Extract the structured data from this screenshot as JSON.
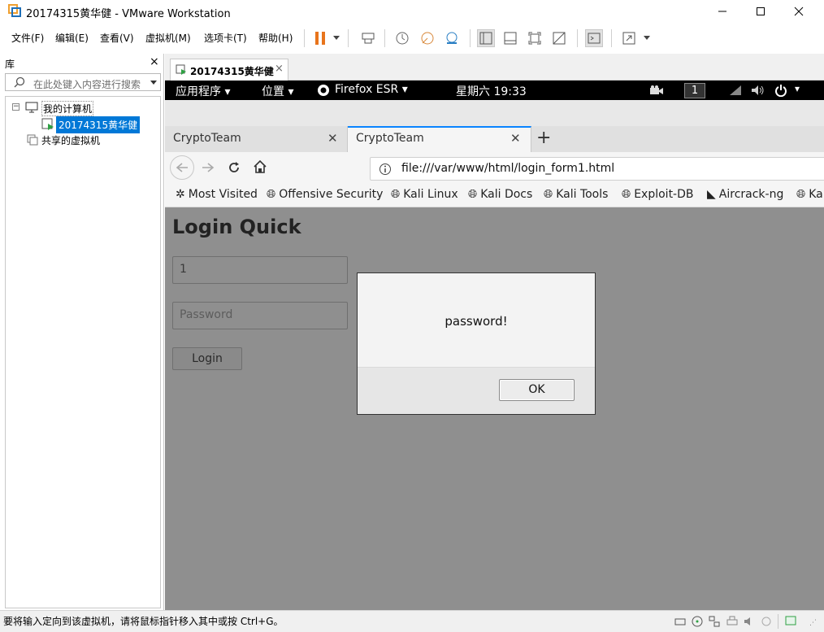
{
  "window": {
    "title": "20174315黄华健 - VMware Workstation",
    "controls": [
      "minimize",
      "maximize",
      "close"
    ]
  },
  "menu": {
    "items": [
      "文件(F)",
      "编辑(E)",
      "查看(V)",
      "虚拟机(M)",
      "选项卡(T)",
      "帮助(H)"
    ]
  },
  "toolbar": {
    "icons": [
      "pause-icon",
      "send-keys-icon",
      "snapshot-icon",
      "revert-snapshot-icon",
      "snapshot-manager-icon",
      "library-view-icon",
      "thumbnail-view-icon",
      "fit-guest-icon",
      "unity-icon",
      "console-view-icon",
      "fullscreen-icon"
    ]
  },
  "library": {
    "header": "库",
    "close": "×",
    "search_placeholder": "在此处键入内容进行搜索",
    "tree": {
      "root": "我的计算机",
      "vm": "20174315黄华健",
      "shared": "共享的虚拟机"
    }
  },
  "vm_tab": {
    "label": "20174315黄华健",
    "close": "×"
  },
  "guest_topbar": {
    "apps": "应用程序",
    "places": "位置",
    "firefox": "Firefox ESR",
    "clock": "星期六 19:33",
    "workspace": "1"
  },
  "firefox": {
    "tabs": [
      {
        "label": "CryptoTeam",
        "active": false
      },
      {
        "label": "CryptoTeam",
        "active": true
      }
    ],
    "new_tab": "+",
    "url": "file:///var/www/html/login_form1.html",
    "bookmarks": [
      "Most Visited",
      "Offensive Security",
      "Kali Linux",
      "Kali Docs",
      "Kali Tools",
      "Exploit-DB",
      "Aircrack-ng",
      "Ka"
    ]
  },
  "page": {
    "title": "Login Quick",
    "username_value": "1",
    "password_placeholder": "Password",
    "login_button": "Login"
  },
  "dialog": {
    "message": "password!",
    "ok_button": "OK"
  },
  "statusbar": {
    "text": "要将输入定向到该虚拟机，请将鼠标指针移入其中或按 Ctrl+G。"
  },
  "colors": {
    "accent": "#0078d7",
    "guest_bg": "#8f8f8f",
    "gnome_bar": "#000000",
    "pause_orange": "#e8741c"
  }
}
